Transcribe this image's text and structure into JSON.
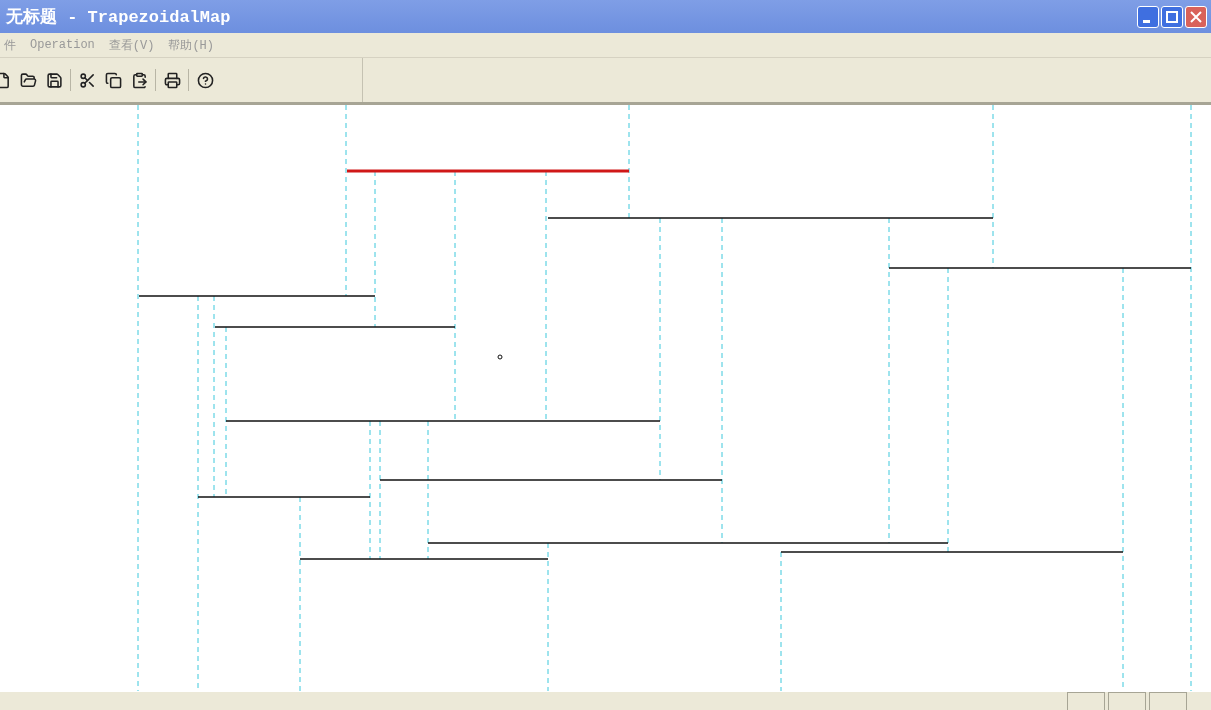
{
  "window": {
    "title": "无标题 - TrapezoidalMap"
  },
  "menu": [
    "件",
    "Operation",
    "查看(V)",
    "帮助(H)"
  ],
  "toolbar": [
    {
      "kind": "new"
    },
    {
      "kind": "open"
    },
    {
      "kind": "save"
    },
    {
      "kind": "separator"
    },
    {
      "kind": "cut"
    },
    {
      "kind": "copy"
    },
    {
      "kind": "paste"
    },
    {
      "kind": "separator"
    },
    {
      "kind": "print"
    },
    {
      "kind": "separator"
    },
    {
      "kind": "help"
    }
  ]
}
